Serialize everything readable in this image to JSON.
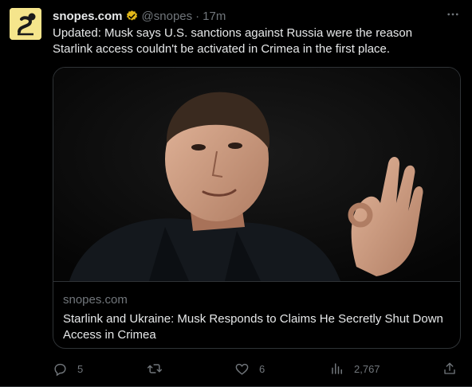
{
  "tweet": {
    "account_name": "snopes.com",
    "handle": "@snopes",
    "separator": "·",
    "time": "17m",
    "text": "Updated: Musk says U.S. sanctions against Russia were the reason Starlink access couldn't be activated in Crimea in the first place."
  },
  "card": {
    "domain": "snopes.com",
    "title": "Starlink and Ukraine: Musk Responds to Claims He Secretly Shut Down Access in Crimea"
  },
  "actions": {
    "replies": "5",
    "retweets": "",
    "likes": "6",
    "views": "2,767"
  },
  "icons": {
    "avatar": "snopes-logo",
    "verified": "verified-badge-icon",
    "more": "more-icon",
    "reply": "reply-icon",
    "retweet": "retweet-icon",
    "like": "heart-icon",
    "views": "analytics-icon",
    "share": "share-icon"
  },
  "colors": {
    "background": "#000000",
    "text": "#e7e9ea",
    "muted": "#71767b",
    "border": "#2f3336",
    "verified": "#e2b719",
    "avatar_bg": "#f5e58c"
  }
}
